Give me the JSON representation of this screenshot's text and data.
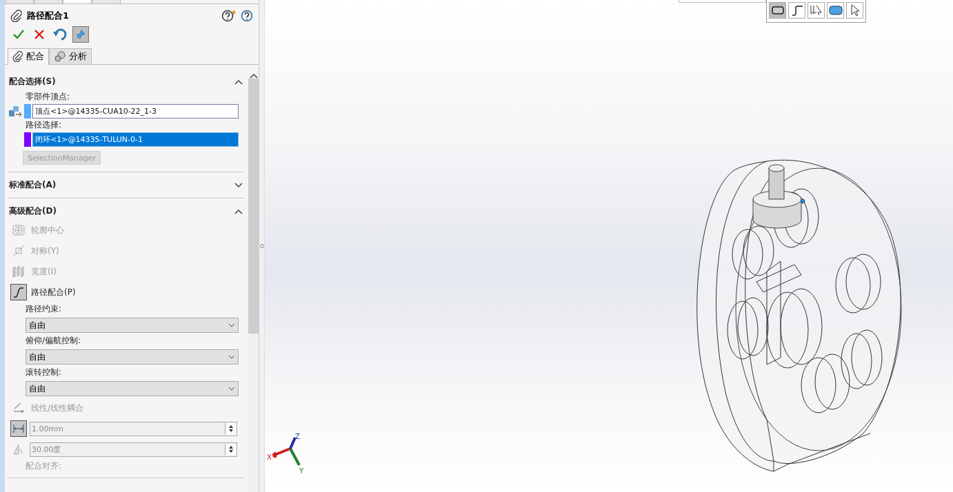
{
  "top_tabs": [
    {
      "selected": false
    },
    {
      "selected": false
    },
    {
      "selected": true
    },
    {
      "selected": false
    }
  ],
  "property_manager": {
    "title": "路径配合1",
    "pinned": true,
    "tabs": [
      {
        "label": "配合",
        "selected": true
      },
      {
        "label": "分析",
        "selected": false
      }
    ],
    "sections": [
      {
        "kind": "selection",
        "title": "配合选择(S)",
        "expanded": true,
        "fields": [
          {
            "label": "零部件顶点:",
            "value": "顶点<1>@14335-CUA10-22_1-3",
            "color": "#55aaff",
            "selected": false
          },
          {
            "label": "路径选择:",
            "value": "闭环<1>@14335-TULUN-0-1",
            "color": "#8000ff",
            "selected": true
          }
        ],
        "button": "SelectionManager"
      },
      {
        "kind": "plain",
        "title": "标准配合(A)",
        "expanded": false
      },
      {
        "kind": "advanced",
        "title": "高级配合(D)",
        "expanded": true,
        "items": [
          {
            "kind": "option",
            "label": "轮廓中心",
            "disabled": true,
            "selected": false
          },
          {
            "kind": "option",
            "label": "对称(Y)",
            "disabled": true,
            "selected": false
          },
          {
            "kind": "option",
            "label": "宽度(I)",
            "disabled": true,
            "selected": false
          },
          {
            "kind": "option",
            "label": "路径配合(P)",
            "disabled": false,
            "selected": true
          },
          {
            "kind": "dropdown",
            "label": "路径约束:",
            "value": "自由"
          },
          {
            "kind": "dropdown",
            "label": "俯仰/偏航控制:",
            "value": "自由"
          },
          {
            "kind": "dropdown",
            "label": "滚转控制:",
            "value": "自由"
          },
          {
            "kind": "option",
            "label": "线性/线性耦合",
            "disabled": true,
            "selected": false
          },
          {
            "kind": "number",
            "value": "1.00mm",
            "disabled": true
          },
          {
            "kind": "number",
            "value": "30.00度",
            "disabled": true
          },
          {
            "kind": "caption",
            "label": "配合对齐:",
            "disabled": true
          }
        ]
      }
    ]
  },
  "view_toolbar": [
    {
      "selected": true
    },
    {
      "selected": false
    },
    {
      "selected": false
    },
    {
      "selected": false
    },
    {
      "selected": false
    }
  ],
  "triad": {
    "x": "X",
    "y": "Y",
    "z": "Z"
  }
}
